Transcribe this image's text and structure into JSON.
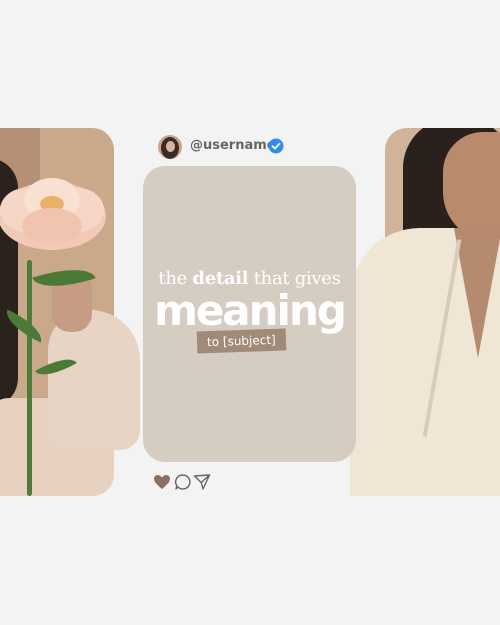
{
  "header": {
    "username": "@username",
    "verified": true
  },
  "post": {
    "headline_prefix": "the",
    "headline_bold": "detail",
    "headline_suffix": "that gives",
    "headline_big": "meaning",
    "subject_tag": "to [subject]"
  },
  "actions": {
    "icons": [
      "heart-icon",
      "comment-icon",
      "share-icon"
    ]
  },
  "colors": {
    "background": "#f3f3f3",
    "card": "#d5cdc1",
    "tag": "#a08a78",
    "verified": "#2f8cf0",
    "username": "#6b6360"
  }
}
